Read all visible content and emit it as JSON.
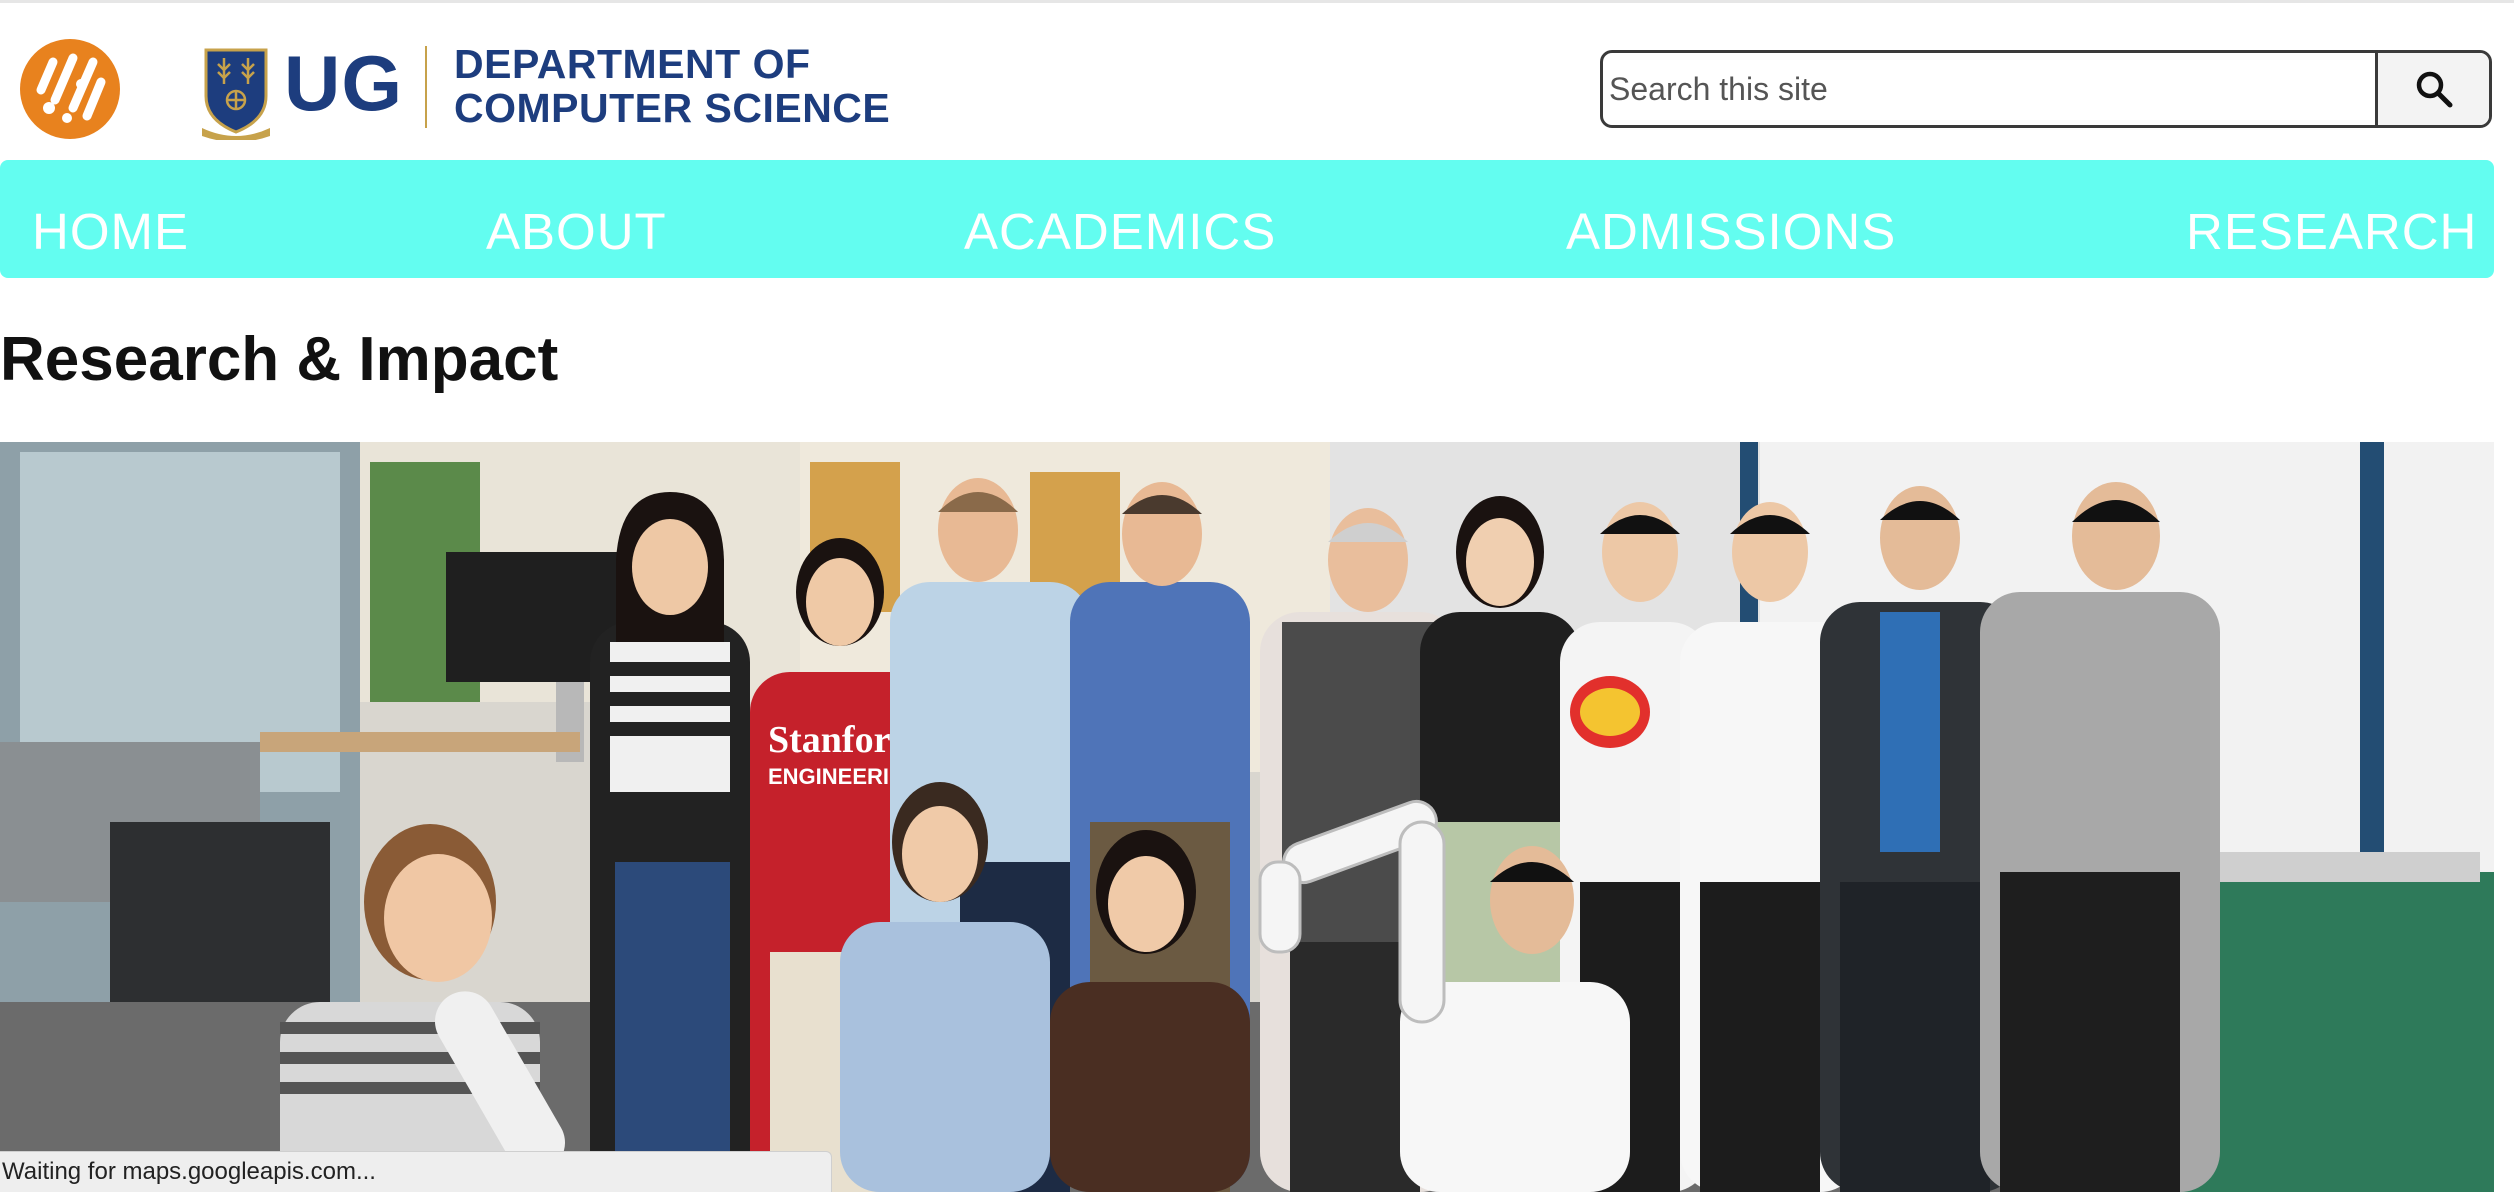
{
  "header": {
    "ug_wordmark": "UG",
    "department_line1": "DEPARTMENT OF",
    "department_line2": "COMPUTER SCIENCE",
    "site_logo_icon": "orange-circle-logo-icon",
    "crest_icon": "university-crest-icon"
  },
  "search": {
    "placeholder": "Search this site",
    "value": "",
    "button_icon": "search-icon"
  },
  "nav": {
    "items": [
      {
        "label": "HOME"
      },
      {
        "label": "ABOUT"
      },
      {
        "label": "ACADEMICS"
      },
      {
        "label": "ADMISSIONS"
      },
      {
        "label": "RESEARCH"
      }
    ]
  },
  "main": {
    "title": "Research & Impact",
    "photo_shirt_text_line1": "Stanford",
    "photo_shirt_text_line2": "ENGINEERING"
  },
  "status": {
    "text": "Waiting for maps.googleapis.com..."
  },
  "colors": {
    "brand_navy": "#1d3d7e",
    "brand_gold": "#c7a24b",
    "logo_orange": "#e8821e",
    "nav_background": "#63fdf0",
    "nav_text": "#ffffff"
  }
}
